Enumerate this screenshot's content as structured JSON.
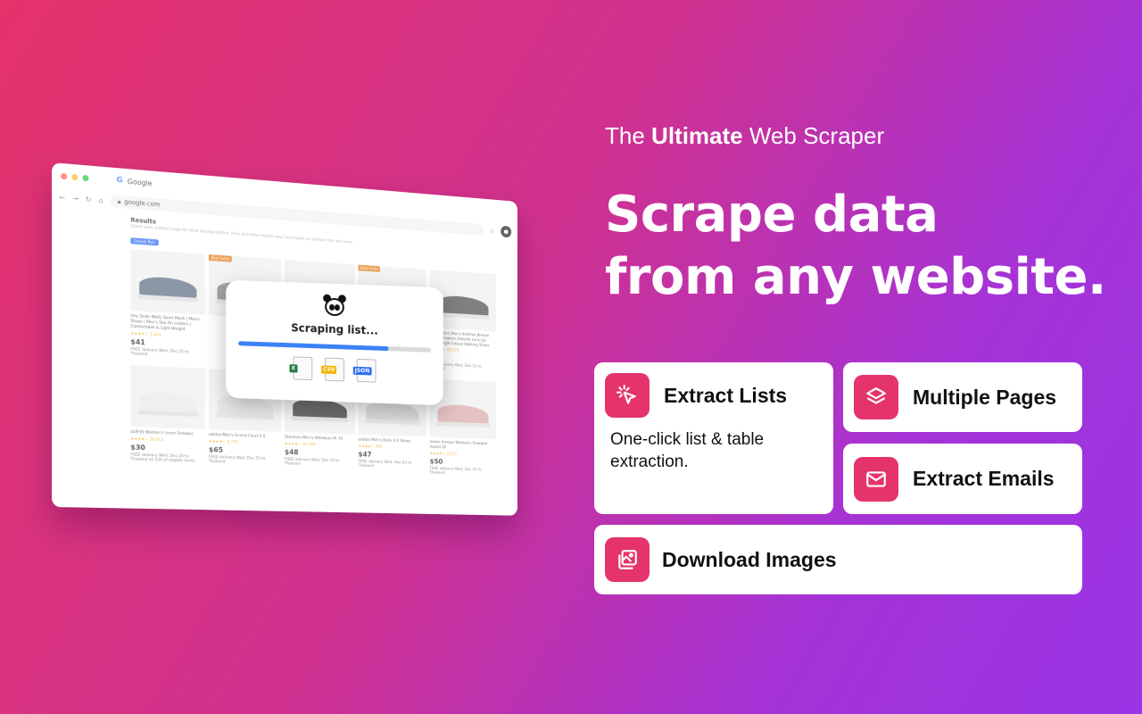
{
  "tagline": {
    "prefix": "The",
    "bold": "Ultimate",
    "suffix": "Web Scraper"
  },
  "headline": {
    "line1": "Scrape data",
    "line2": "from any website."
  },
  "features": {
    "extract_lists": {
      "title": "Extract Lists",
      "desc": "One-click list & table extraction.",
      "icon": "cursor-click-icon"
    },
    "multiple_pages": {
      "title": "Multiple Pages",
      "icon": "layers-icon"
    },
    "extract_emails": {
      "title": "Extract Emails",
      "icon": "mail-icon"
    },
    "download_images": {
      "title": "Download Images",
      "icon": "images-icon"
    }
  },
  "browser": {
    "tab_title": "Google",
    "url": "google.com",
    "results_heading": "Results",
    "results_sub": "Check each product page for other buying options. Price and other details may vary based on product size and color.",
    "chip_label": "Overall Pick",
    "products": [
      {
        "title": "Hey Dude Wally Sport Mesh | Men's Shoes | Men's Slip On Loafers | Comfortable & Light-Weight",
        "stars": "★★★★☆ 1,324",
        "price": "$41",
        "ship": "FREE delivery Wed, Dec 25 to Thailand",
        "color": "#5b6a80",
        "sale": ""
      },
      {
        "title": "",
        "stars": "",
        "price": "",
        "ship": "",
        "color": "#7a7a7a",
        "sale": "Best Seller"
      },
      {
        "title": "",
        "stars": "",
        "price": "",
        "ship": "",
        "color": "#333333",
        "sale": ""
      },
      {
        "title": "",
        "stars": "",
        "price": "",
        "ship": "",
        "color": "#2a2a2a",
        "sale": "Best Seller"
      },
      {
        "title": "Bruno Marc Men's KnitFlex Breeze Mesh Sneakers Oxfords Lace-Up Lightweight Casual Walking Shoes",
        "stars": "★★★★☆ 16,975",
        "price": "$42",
        "ship": "FREE delivery Wed, Dec 25 to Thailand",
        "color": "#4a4a4a",
        "sale": ""
      },
      {
        "title": "GUESS Women's Loven Sneaker",
        "stars": "★★★★☆ 26,613",
        "price": "$30",
        "ship": "FREE delivery Wed, Dec 25 to Thailand on $35 of eligible items",
        "color": "#e8e8e8",
        "sale": ""
      },
      {
        "title": "adidas Men's Grand Court 2.0",
        "stars": "★★★★☆ 4,716",
        "price": "$65",
        "ship": "FREE delivery Wed, Dec 25 to Thailand",
        "color": "#e0e0e0",
        "sale": ""
      },
      {
        "title": "Skechers Men's Afterburn M. Fit",
        "stars": "★★★★☆ 37,308",
        "price": "$48",
        "ship": "FREE delivery Wed, Dec 25 to Thailand",
        "color": "#2d2d2d",
        "sale": ""
      },
      {
        "title": "adidas Men's Daily 4.0 Shoes",
        "stars": "★★★★☆ 982",
        "price": "$47",
        "ship": "FREE delivery Wed, Dec 25 to Thailand",
        "color": "#cfcfcf",
        "sale": ""
      },
      {
        "title": "Under Armour Women's Charged Assert 10",
        "stars": "★★★★☆ 2,113",
        "price": "$50",
        "ship": "FREE delivery Wed, Dec 25 to Thailand",
        "color": "#d8a6a8",
        "sale": ""
      }
    ]
  },
  "modal": {
    "title": "Scraping list...",
    "progress": 0.78,
    "formats": [
      {
        "label": "X",
        "color": "#1d7a3e"
      },
      {
        "label": "CSV",
        "color": "#f4b400"
      },
      {
        "label": "JSON",
        "color": "#2b6df5"
      }
    ]
  },
  "colors": {
    "accent": "#e5336b",
    "gradient_start": "#e5336b",
    "gradient_end": "#9a34e6"
  }
}
